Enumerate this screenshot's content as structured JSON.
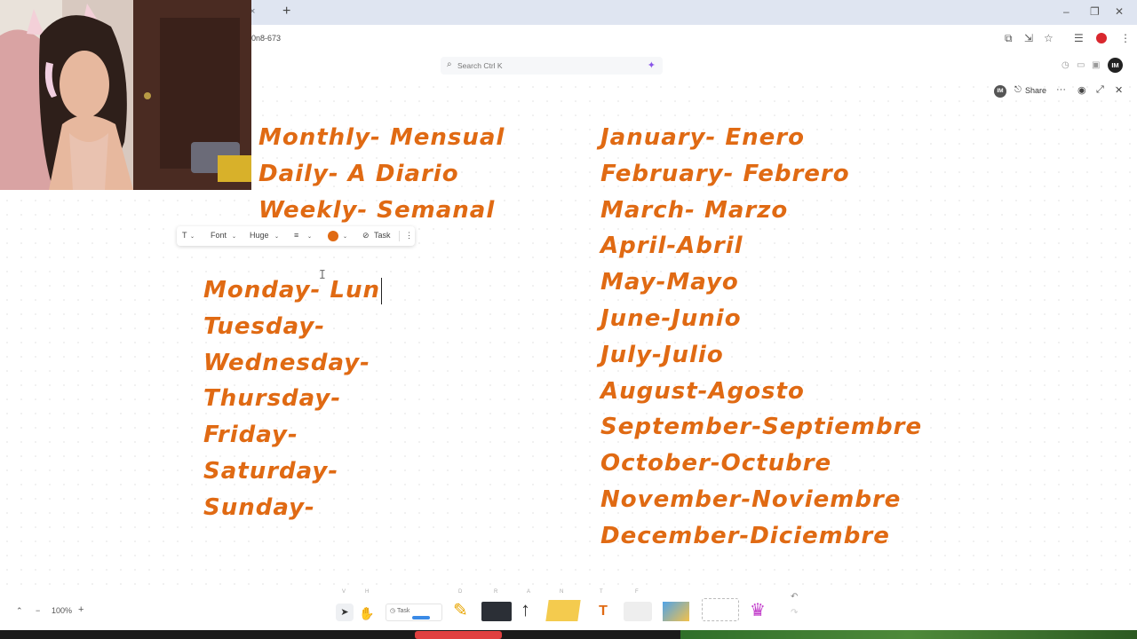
{
  "browser": {
    "url_fragment": "0n8-673",
    "new_tab_symbol": "+",
    "tab_close_symbol": "×",
    "window_controls": [
      "–",
      "❐",
      "✕"
    ]
  },
  "app": {
    "search_placeholder": "Search",
    "search_shortcut": "Ctrl K",
    "avatar_initials": "IM",
    "share_label": "Share",
    "more_symbol": "···"
  },
  "text_toolbar": {
    "type_icon": "T",
    "font_label": "Font",
    "size_label": "Huge",
    "align_icon": "≡",
    "color": "#e06a13",
    "task_label": "Task",
    "more_icon": "⋮"
  },
  "board": {
    "frequency": [
      "Monthly- Mensual",
      "Daily- A Diario",
      "Weekly- Semanal"
    ],
    "days": [
      "Monday- Lun",
      "Tuesday-",
      "Wednesday-",
      "Thursday-",
      "Friday-",
      "Saturday-",
      "Sunday-"
    ],
    "months": [
      "January- Enero",
      "February- Febrero",
      "March- Marzo",
      "April-Abril",
      "May-Mayo",
      "June-Junio",
      "July-Julio",
      "August-Agosto",
      "September-Septiembre",
      "October-Octubre",
      "November-Noviembre",
      "December-Diciembre"
    ],
    "ink_color": "#e06a13"
  },
  "zoom": {
    "level": "100%",
    "minus": "−",
    "plus": "+"
  },
  "dock": {
    "task_chip": "Task",
    "text_tool": "T"
  }
}
